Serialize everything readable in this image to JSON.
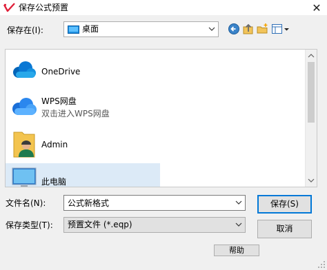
{
  "window": {
    "title": "保存公式预置",
    "close_glyph": "✕"
  },
  "location": {
    "label": "保存在(I):",
    "value": "桌面"
  },
  "toolbar": {
    "back_icon": "back-arrow-icon",
    "up_icon": "up-folder-icon",
    "new_folder_icon": "new-folder-icon",
    "view_icon": "view-menu-icon"
  },
  "files": [
    {
      "name": "OneDrive",
      "subtitle": "",
      "icon": "onedrive-cloud-icon",
      "selected": false
    },
    {
      "name": "WPS网盘",
      "subtitle": "双击进入WPS网盘",
      "icon": "wps-cloud-icon",
      "selected": false
    },
    {
      "name": "Admin",
      "subtitle": "",
      "icon": "user-folder-icon",
      "selected": false
    },
    {
      "name": "此电脑",
      "subtitle": "",
      "icon": "computer-icon",
      "selected": true
    }
  ],
  "filename": {
    "label": "文件名(N):",
    "value": "公式新格式"
  },
  "filetype": {
    "label": "保存类型(T):",
    "value": "预置文件 (*.eqp)"
  },
  "buttons": {
    "save": "保存(S)",
    "cancel": "取消",
    "help": "帮助"
  },
  "colors": {
    "accent": "#0078d7",
    "selection": "#dceaf7",
    "logo": "#e0203a"
  }
}
